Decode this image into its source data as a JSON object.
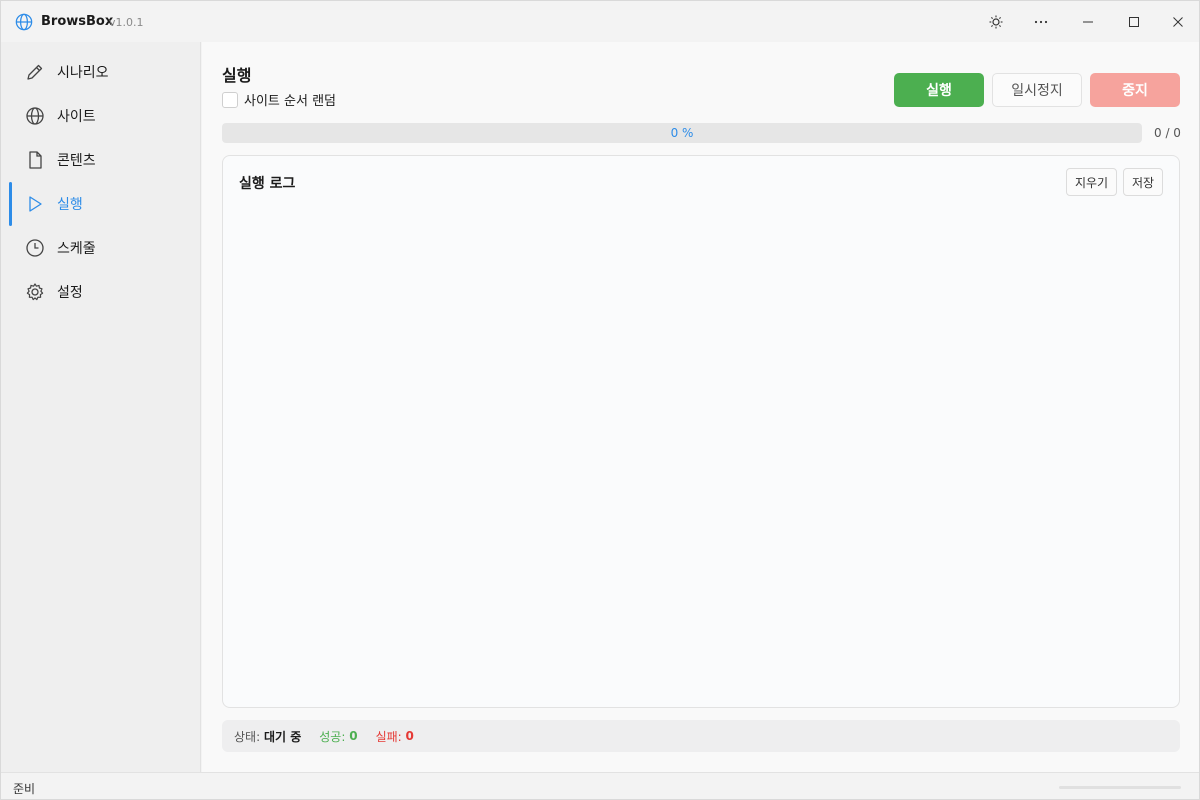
{
  "app": {
    "title": "BrowsBox",
    "version": "v1.0.1"
  },
  "titlebar": {
    "theme_icon": "sun-icon",
    "more_icon": "more-horizontal-icon",
    "minimize_icon": "minimize-icon",
    "maximize_icon": "maximize-icon",
    "close_icon": "close-icon"
  },
  "sidebar": {
    "items": [
      {
        "label": "시나리오",
        "icon": "pencil-icon",
        "active": false
      },
      {
        "label": "사이트",
        "icon": "globe-icon",
        "active": false
      },
      {
        "label": "콘텐츠",
        "icon": "document-icon",
        "active": false
      },
      {
        "label": "실행",
        "icon": "play-icon",
        "active": true
      },
      {
        "label": "스케줄",
        "icon": "clock-icon",
        "active": false
      },
      {
        "label": "설정",
        "icon": "gear-icon",
        "active": false
      }
    ]
  },
  "main": {
    "title": "실행",
    "random_order_label": "사이트 순서 랜덤",
    "random_order_checked": false,
    "buttons": {
      "run": "실행",
      "pause": "일시정지",
      "stop": "중지"
    },
    "progress": {
      "percent_text": "0 %",
      "value": 0,
      "count": "0 / 0"
    },
    "log": {
      "title": "실행 로그",
      "clear_label": "지우기",
      "save_label": "저장"
    },
    "status": {
      "state_label": "상태:",
      "state_value": "대기 중",
      "success_label": "성공:",
      "success_value": "0",
      "fail_label": "실패:",
      "fail_value": "0"
    }
  },
  "footer": {
    "status_text": "준비"
  },
  "colors": {
    "accent": "#2d8ce8",
    "run": "#4caf50",
    "stop": "#f6a39d",
    "fail": "#e53935"
  }
}
